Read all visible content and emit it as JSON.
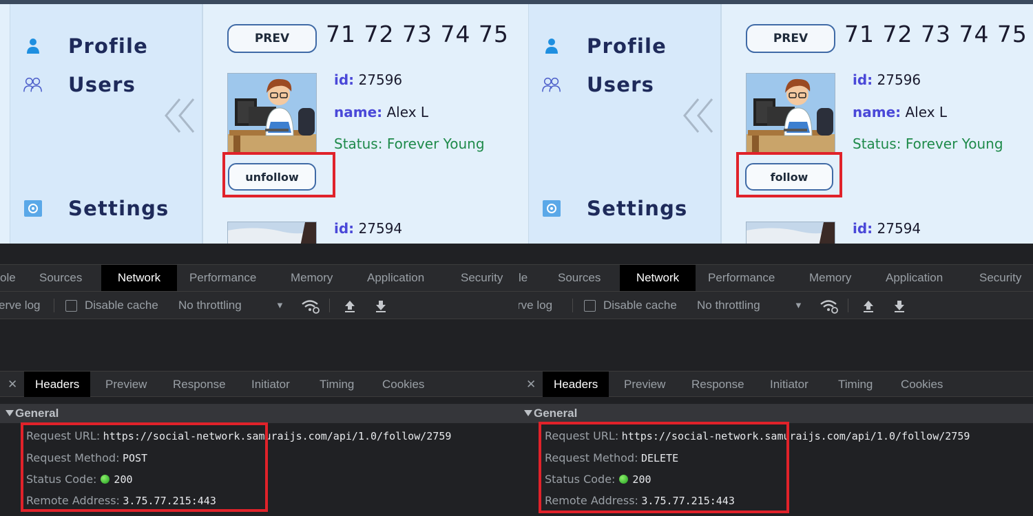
{
  "left": {
    "sidebar": {
      "items": [
        {
          "label": "Profile",
          "icon": "user-icon"
        },
        {
          "label": "Users",
          "icon": "users-icon"
        },
        {
          "label": "Settings",
          "icon": "settings-icon"
        }
      ]
    },
    "pagination": {
      "prev_label": "PREV",
      "pages_text": "71 72 73 74 75 7"
    },
    "users": [
      {
        "id_key": "id:",
        "id": "27596",
        "name_key": "name:",
        "name": "Alex L",
        "status_key": "Status:",
        "status": "Forever Young",
        "button_label": "unfollow"
      },
      {
        "id_key": "id:",
        "id": "27594"
      }
    ],
    "devtools": {
      "tabs": [
        "ole",
        "Sources",
        "Network",
        "Performance",
        "Memory",
        "Application",
        "Security"
      ],
      "active_tab": "Network",
      "toolbar": {
        "preserve_log": "erve log",
        "disable_cache": "Disable cache",
        "throttling": "No throttling"
      },
      "subtabs": [
        "Headers",
        "Preview",
        "Response",
        "Initiator",
        "Timing",
        "Cookies"
      ],
      "active_subtab": "Headers",
      "general_label": "General",
      "headers": {
        "request_url_key": "Request URL:",
        "request_url": "https://social-network.samuraijs.com/api/1.0/follow/2759",
        "method_key": "Request Method:",
        "method": "POST",
        "status_key": "Status Code:",
        "status": "200",
        "remote_key": "Remote Address:",
        "remote": "3.75.77.215:443"
      }
    }
  },
  "right": {
    "sidebar": {
      "items": [
        {
          "label": "Profile",
          "icon": "user-icon"
        },
        {
          "label": "Users",
          "icon": "users-icon"
        },
        {
          "label": "Settings",
          "icon": "settings-icon"
        }
      ]
    },
    "pagination": {
      "prev_label": "PREV",
      "pages_text": "71 72 73 74 75 7"
    },
    "users": [
      {
        "id_key": "id:",
        "id": "27596",
        "name_key": "name:",
        "name": "Alex L",
        "status_key": "Status:",
        "status": "Forever Young",
        "button_label": "follow"
      },
      {
        "id_key": "id:",
        "id": "27594"
      }
    ],
    "devtools": {
      "tabs": [
        "le",
        "Sources",
        "Network",
        "Performance",
        "Memory",
        "Application",
        "Security"
      ],
      "active_tab": "Network",
      "toolbar": {
        "preserve_log": "rve log",
        "disable_cache": "Disable cache",
        "throttling": "No throttling"
      },
      "subtabs": [
        "Headers",
        "Preview",
        "Response",
        "Initiator",
        "Timing",
        "Cookies"
      ],
      "active_subtab": "Headers",
      "general_label": "General",
      "headers": {
        "request_url_key": "Request URL:",
        "request_url": "https://social-network.samuraijs.com/api/1.0/follow/2759",
        "method_key": "Request Method:",
        "method": "DELETE",
        "status_key": "Status Code:",
        "status": "200",
        "remote_key": "Remote Address:",
        "remote": "3.75.77.215:443"
      }
    }
  },
  "colors": {
    "highlight": "#e0222a",
    "app_bg": "#e3f0fb",
    "sidebar_bg": "#d7e9fa",
    "key_text": "#4a48d8",
    "status_text": "#1e8a4a",
    "devtools_bg": "#202124"
  }
}
